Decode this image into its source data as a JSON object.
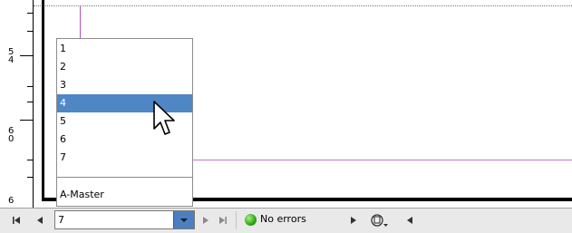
{
  "ruler": {
    "labels": [
      "5 4",
      "6 0",
      "6"
    ]
  },
  "page_list": {
    "items": [
      "1",
      "2",
      "3",
      "4",
      "5",
      "6",
      "7"
    ],
    "selected": "4",
    "master": "A-Master"
  },
  "status_bar": {
    "current_page": "7",
    "status_text": "No errors",
    "status_color": "#2fa51b"
  },
  "colors": {
    "selection": "#4f87c5",
    "guide": "#b255b5"
  }
}
